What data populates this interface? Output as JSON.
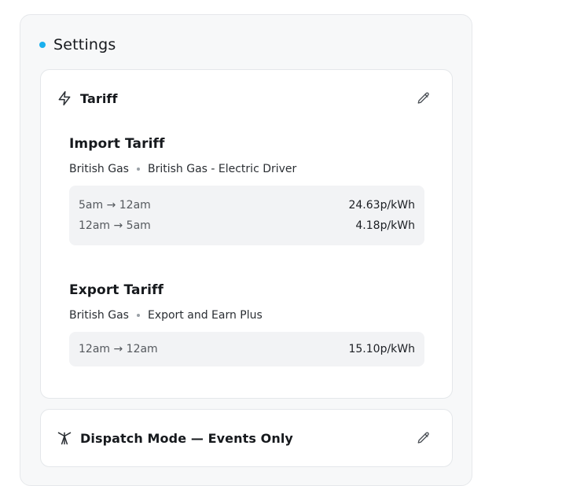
{
  "settings": {
    "title": "Settings",
    "accent_color": "#1ab0ee"
  },
  "tariff_card": {
    "title": "Tariff",
    "icon": "lightning-bolt-icon",
    "edit_icon": "pencil-icon",
    "import": {
      "title": "Import Tariff",
      "supplier": "British Gas",
      "plan": "British Gas - Electric Driver",
      "rates": [
        {
          "time": "5am → 12am",
          "price": "24.63p/kWh"
        },
        {
          "time": "12am → 5am",
          "price": "4.18p/kWh"
        }
      ]
    },
    "export": {
      "title": "Export Tariff",
      "supplier": "British Gas",
      "plan": "Export and Earn Plus",
      "rates": [
        {
          "time": "12am → 12am",
          "price": "15.10p/kWh"
        }
      ]
    }
  },
  "dispatch_card": {
    "title": "Dispatch Mode — Events Only",
    "icon": "antenna-tower-icon",
    "edit_icon": "pencil-icon"
  }
}
